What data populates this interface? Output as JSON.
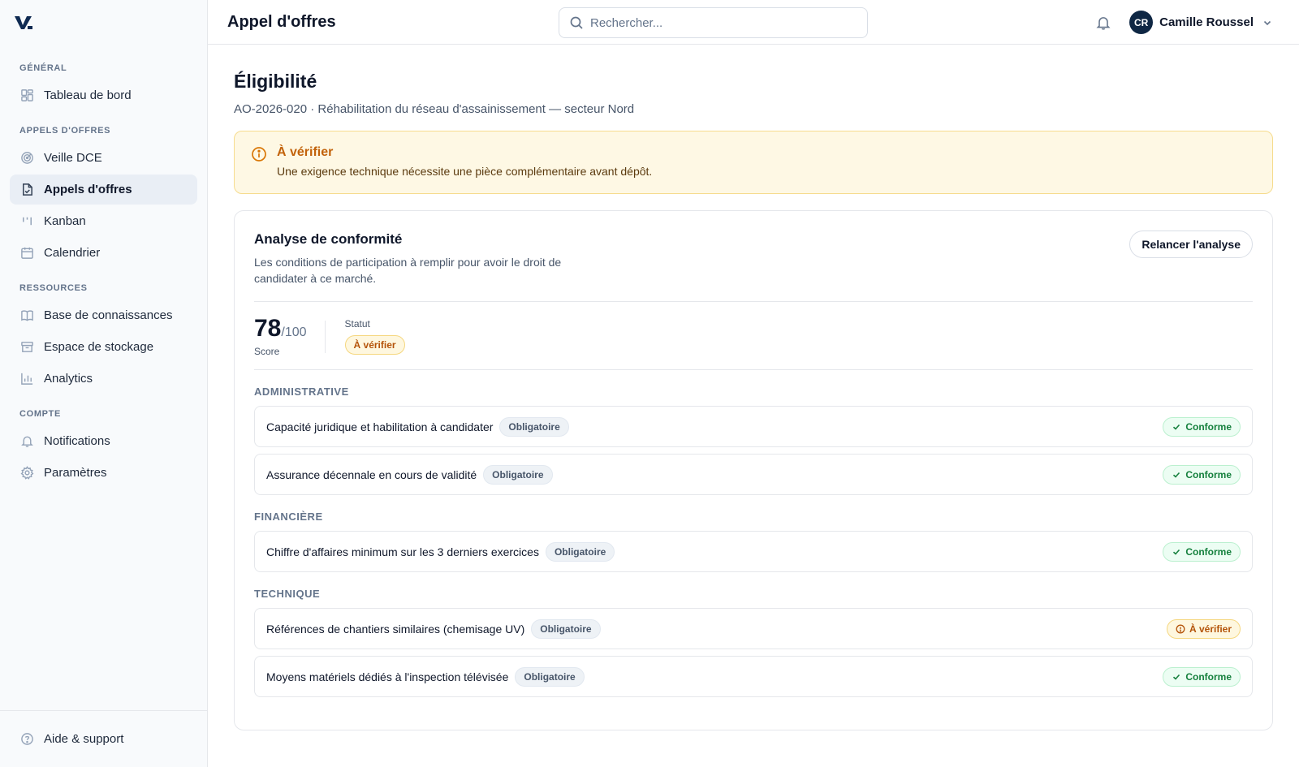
{
  "sidebar": {
    "sections": [
      {
        "title": "GÉNÉRAL",
        "items": [
          {
            "label": "Tableau de bord",
            "icon": "dashboard-icon"
          }
        ]
      },
      {
        "title": "APPELS D'OFFRES",
        "items": [
          {
            "label": "Veille DCE",
            "icon": "radar-icon"
          },
          {
            "label": "Appels d'offres",
            "icon": "document-icon",
            "active": true
          },
          {
            "label": "Kanban",
            "icon": "kanban-icon"
          },
          {
            "label": "Calendrier",
            "icon": "calendar-icon"
          }
        ]
      },
      {
        "title": "RESSOURCES",
        "items": [
          {
            "label": "Base de connaissances",
            "icon": "book-icon"
          },
          {
            "label": "Espace de stockage",
            "icon": "archive-icon"
          },
          {
            "label": "Analytics",
            "icon": "chart-icon"
          }
        ]
      },
      {
        "title": "COMPTE",
        "items": [
          {
            "label": "Notifications",
            "icon": "bell-icon"
          },
          {
            "label": "Paramètres",
            "icon": "gear-icon"
          }
        ]
      }
    ],
    "footer": {
      "label": "Aide & support",
      "icon": "help-icon"
    }
  },
  "topbar": {
    "title": "Appel d'offres",
    "search_placeholder": "Rechercher...",
    "user": {
      "initials": "CR",
      "name": "Camille Roussel"
    }
  },
  "page": {
    "title": "Éligibilité",
    "subtitle": "AO-2026-020 · Réhabilitation du réseau d'assainissement — secteur Nord"
  },
  "alert": {
    "title": "À vérifier",
    "text": "Une exigence technique nécessite une pièce complémentaire avant dépôt."
  },
  "analysis": {
    "title": "Analyse de conformité",
    "description": "Les conditions de participation à remplir pour avoir le droit de candidater à ce marché.",
    "rerun_label": "Relancer l'analyse",
    "score": {
      "value": "78",
      "max": "/100",
      "label": "Score"
    },
    "status": {
      "label": "Statut",
      "value": "À vérifier"
    },
    "groups": [
      {
        "title": "ADMINISTRATIVE",
        "items": [
          {
            "label": "Capacité juridique et habilitation à candidater",
            "tag": "Obligatoire",
            "status": "Conforme",
            "state": "ok"
          },
          {
            "label": "Assurance décennale en cours de validité",
            "tag": "Obligatoire",
            "status": "Conforme",
            "state": "ok"
          }
        ]
      },
      {
        "title": "FINANCIÈRE",
        "items": [
          {
            "label": "Chiffre d'affaires minimum sur les 3 derniers exercices",
            "tag": "Obligatoire",
            "status": "Conforme",
            "state": "ok"
          }
        ]
      },
      {
        "title": "TECHNIQUE",
        "items": [
          {
            "label": "Références de chantiers similaires (chemisage UV)",
            "tag": "Obligatoire",
            "status": "À vérifier",
            "state": "warn"
          },
          {
            "label": "Moyens matériels dédiés à l'inspection télévisée",
            "tag": "Obligatoire",
            "status": "Conforme",
            "state": "ok"
          }
        ]
      }
    ]
  },
  "colors": {
    "ok": "#15803d",
    "warn": "#b45309",
    "avatar": "#0f2744",
    "active_bg": "#e9eef5"
  }
}
